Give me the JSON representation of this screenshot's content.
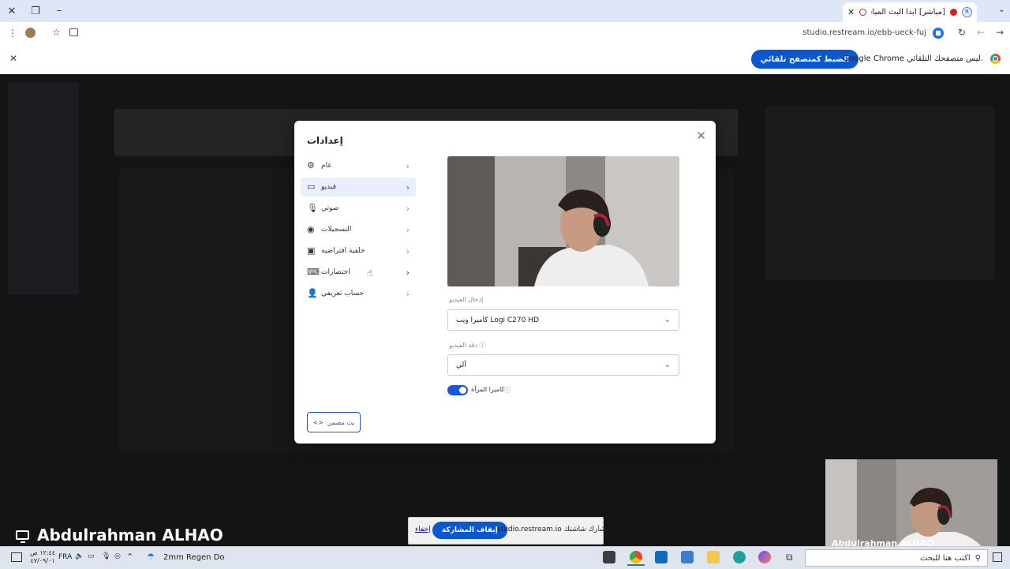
{
  "browser": {
    "tab_title": "[مباشر] ابدأ البث المباشر",
    "tab_favicon": "R",
    "new_tab_label": "+",
    "url": "studio.restream.io/ebb-ueck-fuj",
    "infobar_text": "Google Chrome ليس متصفحك التلقائي.",
    "infobar_button": "الضبط كمتصفح تلقائي"
  },
  "modal": {
    "title": "إعدادات",
    "menu": [
      {
        "label": "عام",
        "icon": "gear-icon"
      },
      {
        "label": "فيديو",
        "icon": "video-icon",
        "active": true
      },
      {
        "label": "صوتي",
        "icon": "microphone-icon"
      },
      {
        "label": "التسجيلات",
        "icon": "record-icon"
      },
      {
        "label": "خلفية افتراضية",
        "icon": "image-icon"
      },
      {
        "label": "اختصارات",
        "icon": "keyboard-icon"
      },
      {
        "label": "حساب تعريفي",
        "icon": "user-icon"
      }
    ],
    "video_input_label": "إدخال الفيديو",
    "video_input_value": "كاميرا ويب Logi C270 HD",
    "video_quality_label": "دقة الفيديو",
    "video_quality_value": "آلي",
    "mirror_label": "كاميرا المرآة",
    "mirror_on": true,
    "embed_button": "بث مضمن"
  },
  "presenter_name": "Abdulrahman ALHAO",
  "share_bar": {
    "hide_label": "إخفاء",
    "stop_label": "إيقاف المشاركة",
    "text": "studio.restream.io يشارك شاشتك"
  },
  "camera_thumb_name": "Abdulrahman ALHAO",
  "taskbar": {
    "search_placeholder": "اكتب هنا للبحث",
    "weather": "2mm Regen Do",
    "language": "FRA",
    "time": "١٢:٤٤ ص",
    "date": "٤٧/٠٩/٠١"
  },
  "colors": {
    "accent": "#0b57d0",
    "active_menu_bg": "#e9efff",
    "toggle_on": "#1a56db"
  }
}
